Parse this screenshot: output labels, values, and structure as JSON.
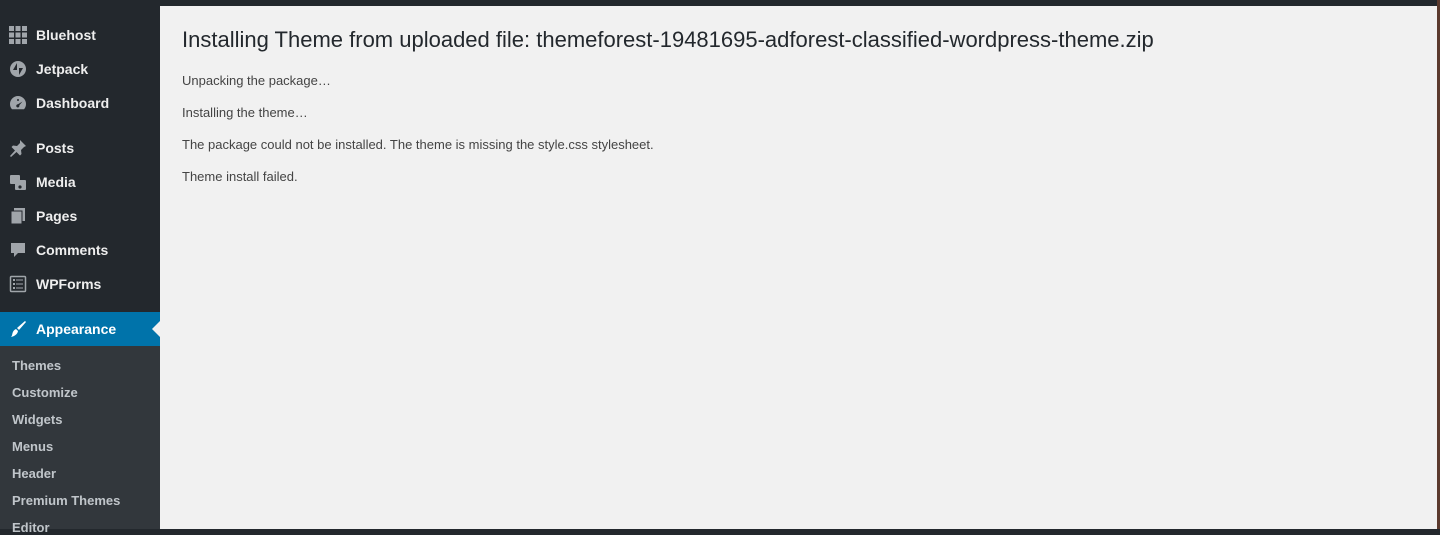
{
  "sidebar": {
    "items": [
      {
        "label": "Bluehost",
        "icon": "grid-icon"
      },
      {
        "label": "Jetpack",
        "icon": "jetpack-icon"
      },
      {
        "label": "Dashboard",
        "icon": "dashboard-icon"
      },
      {
        "label": "Posts",
        "icon": "pin-icon"
      },
      {
        "label": "Media",
        "icon": "media-icon"
      },
      {
        "label": "Pages",
        "icon": "pages-icon"
      },
      {
        "label": "Comments",
        "icon": "comment-icon"
      },
      {
        "label": "WPForms",
        "icon": "form-icon"
      },
      {
        "label": "Appearance",
        "icon": "brush-icon",
        "current": true
      }
    ],
    "submenu": [
      "Themes",
      "Customize",
      "Widgets",
      "Menus",
      "Header",
      "Premium Themes",
      "Editor"
    ]
  },
  "main": {
    "title": "Installing Theme from uploaded file: themeforest-19481695-adforest-classified-wordpress-theme.zip",
    "messages": [
      "Unpacking the package…",
      "Installing the theme…",
      "The package could not be installed. The theme is missing the style.css stylesheet.",
      "Theme install failed."
    ]
  },
  "colors": {
    "sidebar_bg": "#23282d",
    "submenu_bg": "#32373c",
    "accent": "#0073aa",
    "content_bg": "#f1f1f1"
  }
}
